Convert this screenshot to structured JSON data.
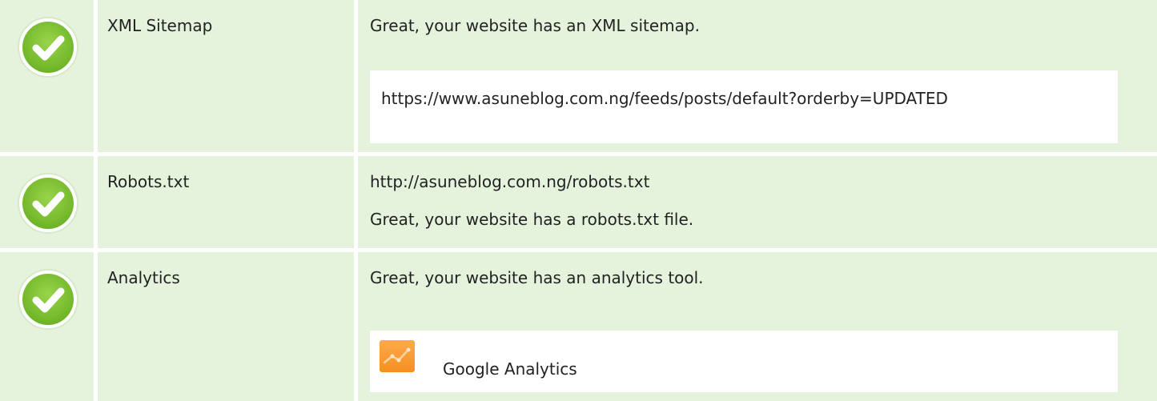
{
  "rows": [
    {
      "label": "XML Sitemap",
      "status_icon": "check-circle-icon",
      "message": "Great, your website has an XML sitemap.",
      "sitemap_url": "https://www.asuneblog.com.ng/feeds/posts/default?orderby=UPDATED"
    },
    {
      "label": "Robots.txt",
      "status_icon": "check-circle-icon",
      "robots_url": "http://asuneblog.com.ng/robots.txt",
      "message": "Great, your website has a robots.txt file."
    },
    {
      "label": "Analytics",
      "status_icon": "check-circle-icon",
      "message": "Great, your website has an analytics tool.",
      "tool": {
        "icon": "google-analytics-icon",
        "name": "Google Analytics"
      }
    }
  ],
  "colors": {
    "row_background": "#e5f3dc",
    "check_green": "#7cc02b",
    "analytics_orange": "#f7931e"
  }
}
